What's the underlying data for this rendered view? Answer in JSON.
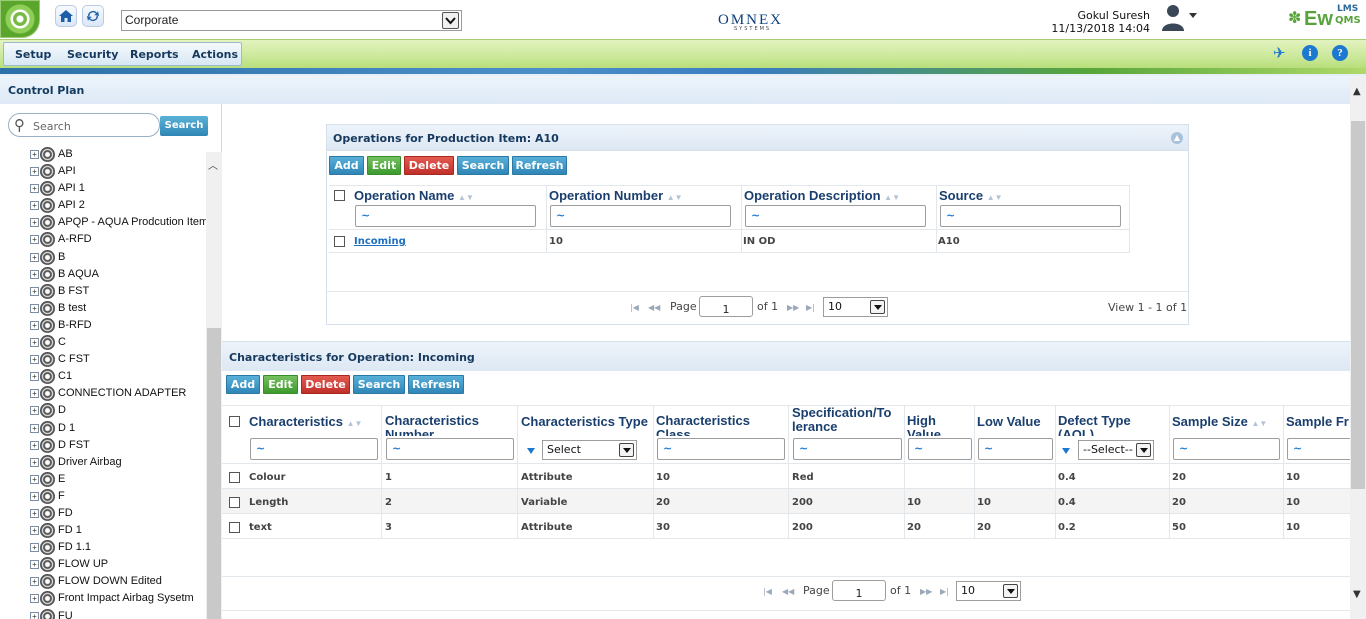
{
  "header": {
    "company": "Corporate",
    "brand": "OMNEX",
    "brand_sub": "SYSTEMS",
    "user_name": "Gokul Suresh",
    "datetime": "11/13/2018 14:04",
    "product_ew": "Ew",
    "product_lms": "LMS",
    "product_qms": "QMS"
  },
  "menu": {
    "setup": "Setup",
    "security": "Security",
    "reports": "Reports",
    "actions": "Actions"
  },
  "page": {
    "title": "Control Plan"
  },
  "tree": {
    "search_placeholder": "Search",
    "search_button": "Search",
    "items": [
      "AB",
      "API",
      "API 1",
      "API 2",
      "APQP - AQUA Prodcution Item",
      "A-RFD",
      "B",
      "B AQUA",
      "B FST",
      "B test",
      "B-RFD",
      "C",
      "C FST",
      "C1",
      "CONNECTION ADAPTER",
      "D",
      "D 1",
      "D FST",
      "Driver Airbag",
      "E",
      "F",
      "FD",
      "FD 1",
      "FD 1.1",
      "FLOW UP",
      "FLOW DOWN Edited",
      "Front Impact Airbag Sysetm",
      "FU"
    ]
  },
  "ops": {
    "title": "Operations for Production Item: A10",
    "buttons": {
      "add": "Add",
      "edit": "Edit",
      "delete": "Delete",
      "search": "Search",
      "refresh": "Refresh"
    },
    "columns": [
      "Operation Name",
      "Operation Number",
      "Operation Description",
      "Source"
    ],
    "filter": "~",
    "row": {
      "name": "Incoming",
      "number": "10",
      "description": "IN OD",
      "source": "A10"
    },
    "pager": {
      "page_label": "Page",
      "page": "1",
      "of": "of 1",
      "size": "10",
      "view": "View 1 - 1 of 1"
    }
  },
  "chars": {
    "title": "Characteristics for Operation: Incoming",
    "buttons": {
      "add": "Add",
      "edit": "Edit",
      "delete": "Delete",
      "search": "Search",
      "refresh": "Refresh"
    },
    "columns": [
      "Characteristics",
      "Characteristics Number",
      "Characteristics Type",
      "Characteristics Class",
      "Specification/To lerance",
      "High Value",
      "Low Value",
      "Defect Type (AQL)",
      "Sample Size",
      "Sample Fr"
    ],
    "filter": "~",
    "type_select": "Select",
    "defect_select": "--Select--",
    "rows": [
      [
        "Colour",
        "1",
        "Attribute",
        "10",
        "Red",
        "",
        "",
        "0.4",
        "20",
        "10"
      ],
      [
        "Length",
        "2",
        "Variable",
        "20",
        "200",
        "10",
        "10",
        "0.4",
        "20",
        "10"
      ],
      [
        "text",
        "3",
        "Attribute",
        "30",
        "200",
        "20",
        "20",
        "0.2",
        "50",
        "10"
      ]
    ],
    "pager": {
      "page_label": "Page",
      "page": "1",
      "of": "of 1",
      "size": "10"
    }
  },
  "colors": {
    "accent": "#1d79cf",
    "menubar": "#cbe899",
    "title": "#16395e"
  }
}
